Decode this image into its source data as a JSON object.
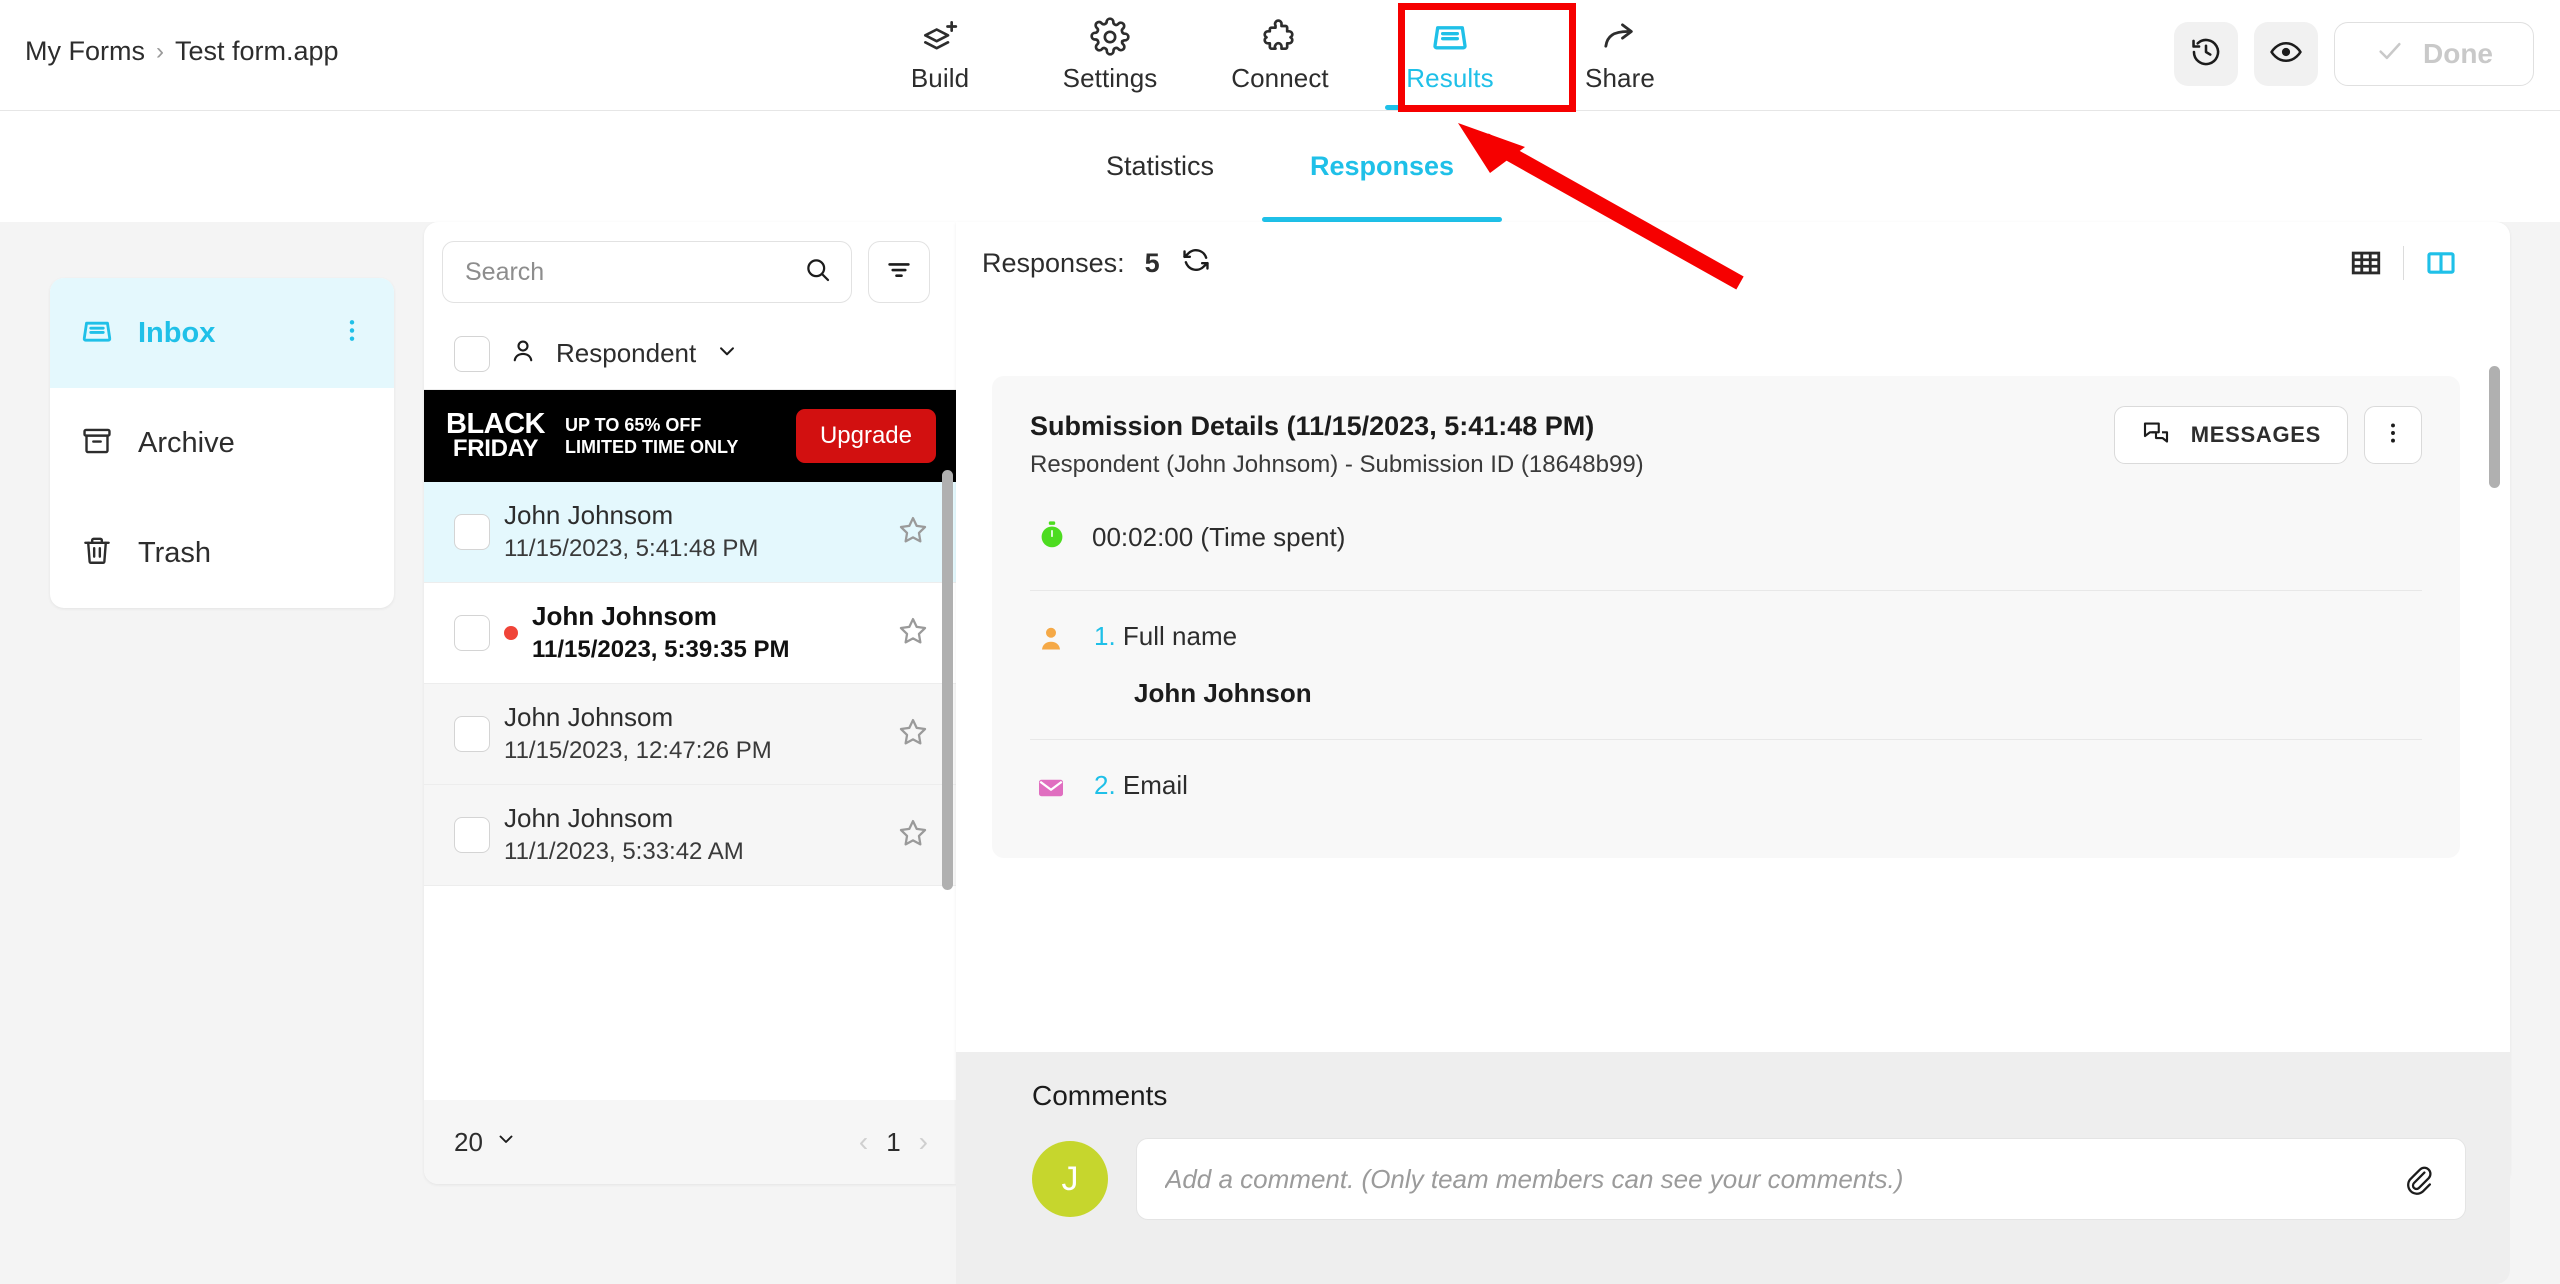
{
  "header": {
    "breadcrumb": {
      "root": "My Forms",
      "separator": "›",
      "current": "Test form.app"
    },
    "nav": [
      {
        "label": "Build",
        "icon": "layers-plus-icon",
        "active": false
      },
      {
        "label": "Settings",
        "icon": "gear-icon",
        "active": false
      },
      {
        "label": "Connect",
        "icon": "puzzle-piece-icon",
        "active": false
      },
      {
        "label": "Results",
        "icon": "inbox-tray-icon",
        "active": true
      },
      {
        "label": "Share",
        "icon": "share-arrow-icon",
        "active": false
      }
    ],
    "actions": {
      "history_icon": "history-clock-icon",
      "preview_icon": "eye-icon",
      "done_label": "Done"
    }
  },
  "subtabs": [
    {
      "label": "Statistics",
      "active": false
    },
    {
      "label": "Responses",
      "active": true
    }
  ],
  "sidebar": {
    "items": [
      {
        "label": "Inbox",
        "icon": "inbox-icon",
        "active": true
      },
      {
        "label": "Archive",
        "icon": "archive-box-icon",
        "active": false
      },
      {
        "label": "Trash",
        "icon": "trash-icon",
        "active": false
      }
    ]
  },
  "list": {
    "search": {
      "value": "",
      "placeholder": "Search",
      "icon": "search-icon"
    },
    "filter_icon": "filter-icon",
    "column_header": {
      "label": "Respondent",
      "icon": "person-icon",
      "chevron": "chevron-down-icon"
    },
    "promo": {
      "title_line1": "BLACK",
      "title_line2": "FRIDAY",
      "text": "UP TO 65% OFF LIMITED TIME ONLY",
      "button_label": "Upgrade",
      "button_color": "#d21010",
      "background": "#000000"
    },
    "items": [
      {
        "name": "John Johnsom",
        "date": "11/15/2023, 5:41:48 PM",
        "selected": true,
        "unread": false,
        "starred": false
      },
      {
        "name": "John Johnsom",
        "date": "11/15/2023, 5:39:35 PM",
        "selected": false,
        "unread": true,
        "starred": false
      },
      {
        "name": "John Johnsom",
        "date": "11/15/2023, 12:47:26 PM",
        "selected": false,
        "unread": false,
        "starred": false
      },
      {
        "name": "John Johnsom",
        "date": "11/1/2023, 5:33:42 AM",
        "selected": false,
        "unread": false,
        "starred": false
      }
    ],
    "footer": {
      "page_size": "20",
      "page_size_chevron": "chevron-down-icon",
      "prev": "‹",
      "page": "1",
      "next": "›"
    }
  },
  "detail": {
    "responses_label": "Responses:",
    "responses_count": "5",
    "refresh_icon": "refresh-icon",
    "view_toggle": [
      {
        "name": "table-view",
        "icon": "table-grid-icon",
        "active": false
      },
      {
        "name": "split-view",
        "icon": "split-panel-icon",
        "active": true
      }
    ],
    "submission": {
      "title": "Submission Details (11/15/2023, 5:41:48 PM)",
      "subtitle": "Respondent (John Johnsom) - Submission ID (18648b99)",
      "messages_label": "MESSAGES",
      "messages_icon": "chat-bubbles-icon",
      "kebab_icon": "kebab-menu-icon",
      "time_spent": "00:02:00 (Time spent)",
      "time_icon": "stopwatch-icon",
      "fields": [
        {
          "number": "1.",
          "label": "Full name",
          "answer": "John Johnson",
          "icon": "person-icon",
          "icon_color": "#f5a947"
        },
        {
          "number": "2.",
          "label": "Email",
          "answer": "",
          "icon": "envelope-icon",
          "icon_color": "#e06ec0"
        }
      ]
    }
  },
  "comments": {
    "title": "Comments",
    "avatar_initial": "J",
    "avatar_color": "#c6d62d",
    "input_value": "",
    "input_placeholder": "Add a comment. (Only team members can see your comments.)",
    "attach_icon": "paperclip-icon"
  },
  "annotation": {
    "color": "#f60000",
    "target": "Results"
  }
}
